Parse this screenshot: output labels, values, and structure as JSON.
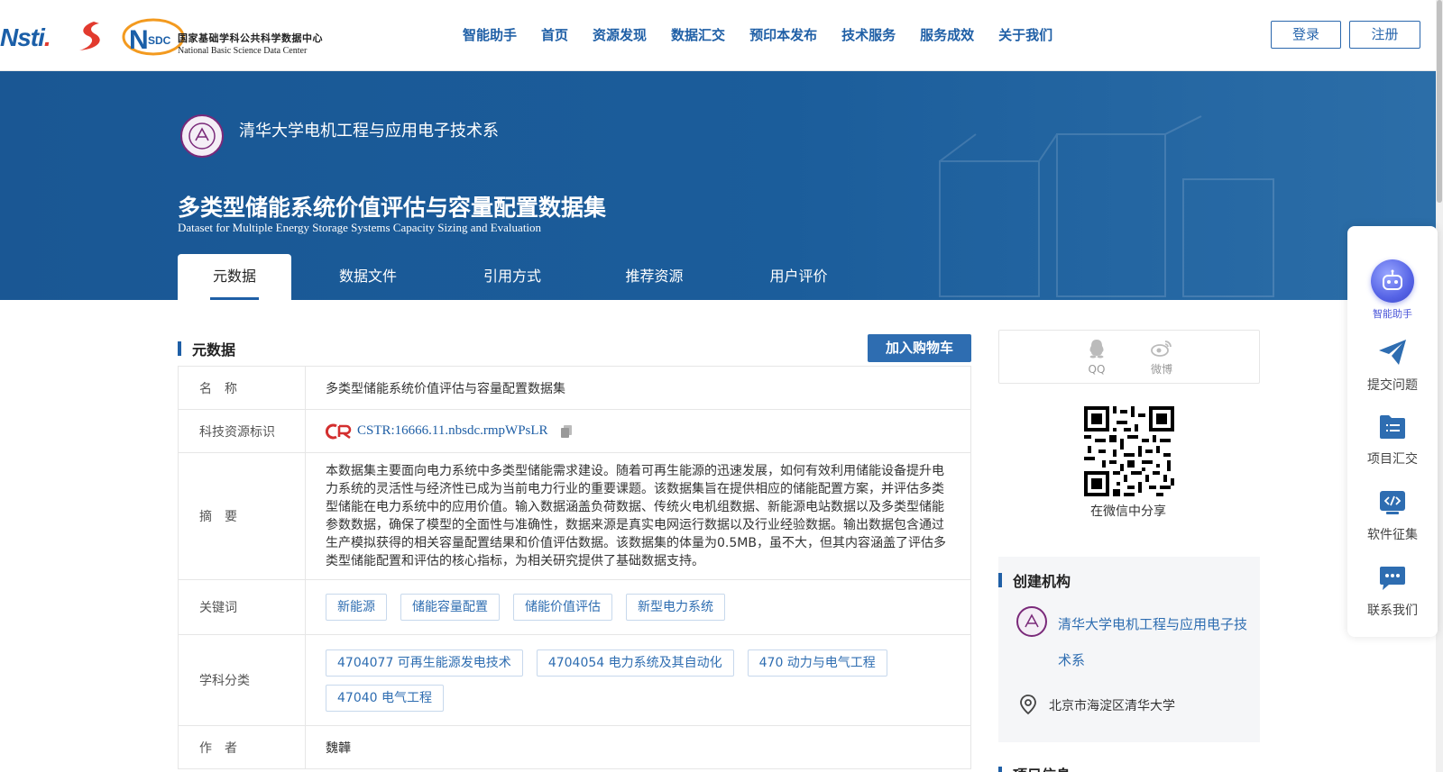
{
  "header": {
    "logo_cstr": "cstr",
    "logo_nsdc_abbr": "NSDC",
    "logo_nsdc_cn": "国家基础学科公共科学数据中心",
    "logo_nsdc_en": "National Basic Science Data Center",
    "nav": [
      "智能助手",
      "首页",
      "资源发现",
      "数据汇交",
      "预印本发布",
      "技术服务",
      "服务成效",
      "关于我们"
    ],
    "login_label": "登录",
    "register_label": "注册"
  },
  "banner": {
    "institution": "清华大学电机工程与应用电子技术系",
    "title": "多类型储能系统价值评估与容量配置数据集",
    "subtitle": "Dataset for Multiple Energy Storage Systems Capacity Sizing and Evaluation",
    "tabs": [
      "元数据",
      "数据文件",
      "引用方式",
      "推荐资源",
      "用户评价"
    ]
  },
  "metadata": {
    "section_title": "元数据",
    "cart_label": "加入购物车",
    "rows": {
      "name": {
        "label": "名　称",
        "value": "多类型储能系统价值评估与容量配置数据集"
      },
      "identifier": {
        "label": "科技资源标识",
        "badge": "CSTR",
        "value": "CSTR:16666.11.nbsdc.rmpWPsLR"
      },
      "abstract": {
        "label": "摘　要",
        "value": "本数据集主要面向电力系统中多类型储能需求建设。随着可再生能源的迅速发展，如何有效利用储能设备提升电力系统的灵活性与经济性已成为当前电力行业的重要课题。该数据集旨在提供相应的储能配置方案，并评估多类型储能在电力系统中的应用价值。输入数据涵盖负荷数据、传统火电机组数据、新能源电站数据以及多类型储能参数数据，确保了模型的全面性与准确性，数据来源是真实电网运行数据以及行业经验数据。输出数据包含通过生产模拟获得的相关容量配置结果和价值评估数据。该数据集的体量为0.5MB，虽不大，但其内容涵盖了评估多类型储能配置和评估的核心指标，为相关研究提供了基础数据支持。"
      },
      "keywords": {
        "label": "关键词",
        "tags": [
          "新能源",
          "储能容量配置",
          "储能价值评估",
          "新型电力系统"
        ]
      },
      "subjects": {
        "label": "学科分类",
        "tags": [
          "4704077 可再生能源发电技术",
          "4704054 电力系统及其自动化",
          "470 动力与电气工程",
          "47040 电气工程"
        ]
      },
      "authors": {
        "label": "作　者",
        "value": "魏韡"
      }
    }
  },
  "sidebar_right": {
    "share": [
      {
        "label": "QQ",
        "icon": "qq-icon"
      },
      {
        "label": "微博",
        "icon": "weibo-icon"
      }
    ],
    "qr_caption": "在微信中分享",
    "org": {
      "title": "创建机构",
      "name": "清华大学电机工程与应用电子技术系",
      "address": "北京市海淀区清华大学"
    },
    "project_title": "项目信息"
  },
  "float_bar": [
    {
      "label": "智能助手",
      "icon": "robot-icon"
    },
    {
      "label": "提交问题",
      "icon": "paper-plane-icon"
    },
    {
      "label": "项目汇交",
      "icon": "folder-list-icon"
    },
    {
      "label": "软件征集",
      "icon": "code-icon"
    },
    {
      "label": "联系我们",
      "icon": "chat-icon"
    }
  ],
  "colors": {
    "brand": "#1f5fa6",
    "banner": "#1b5d9b",
    "ai_accent": "#5664e6"
  }
}
